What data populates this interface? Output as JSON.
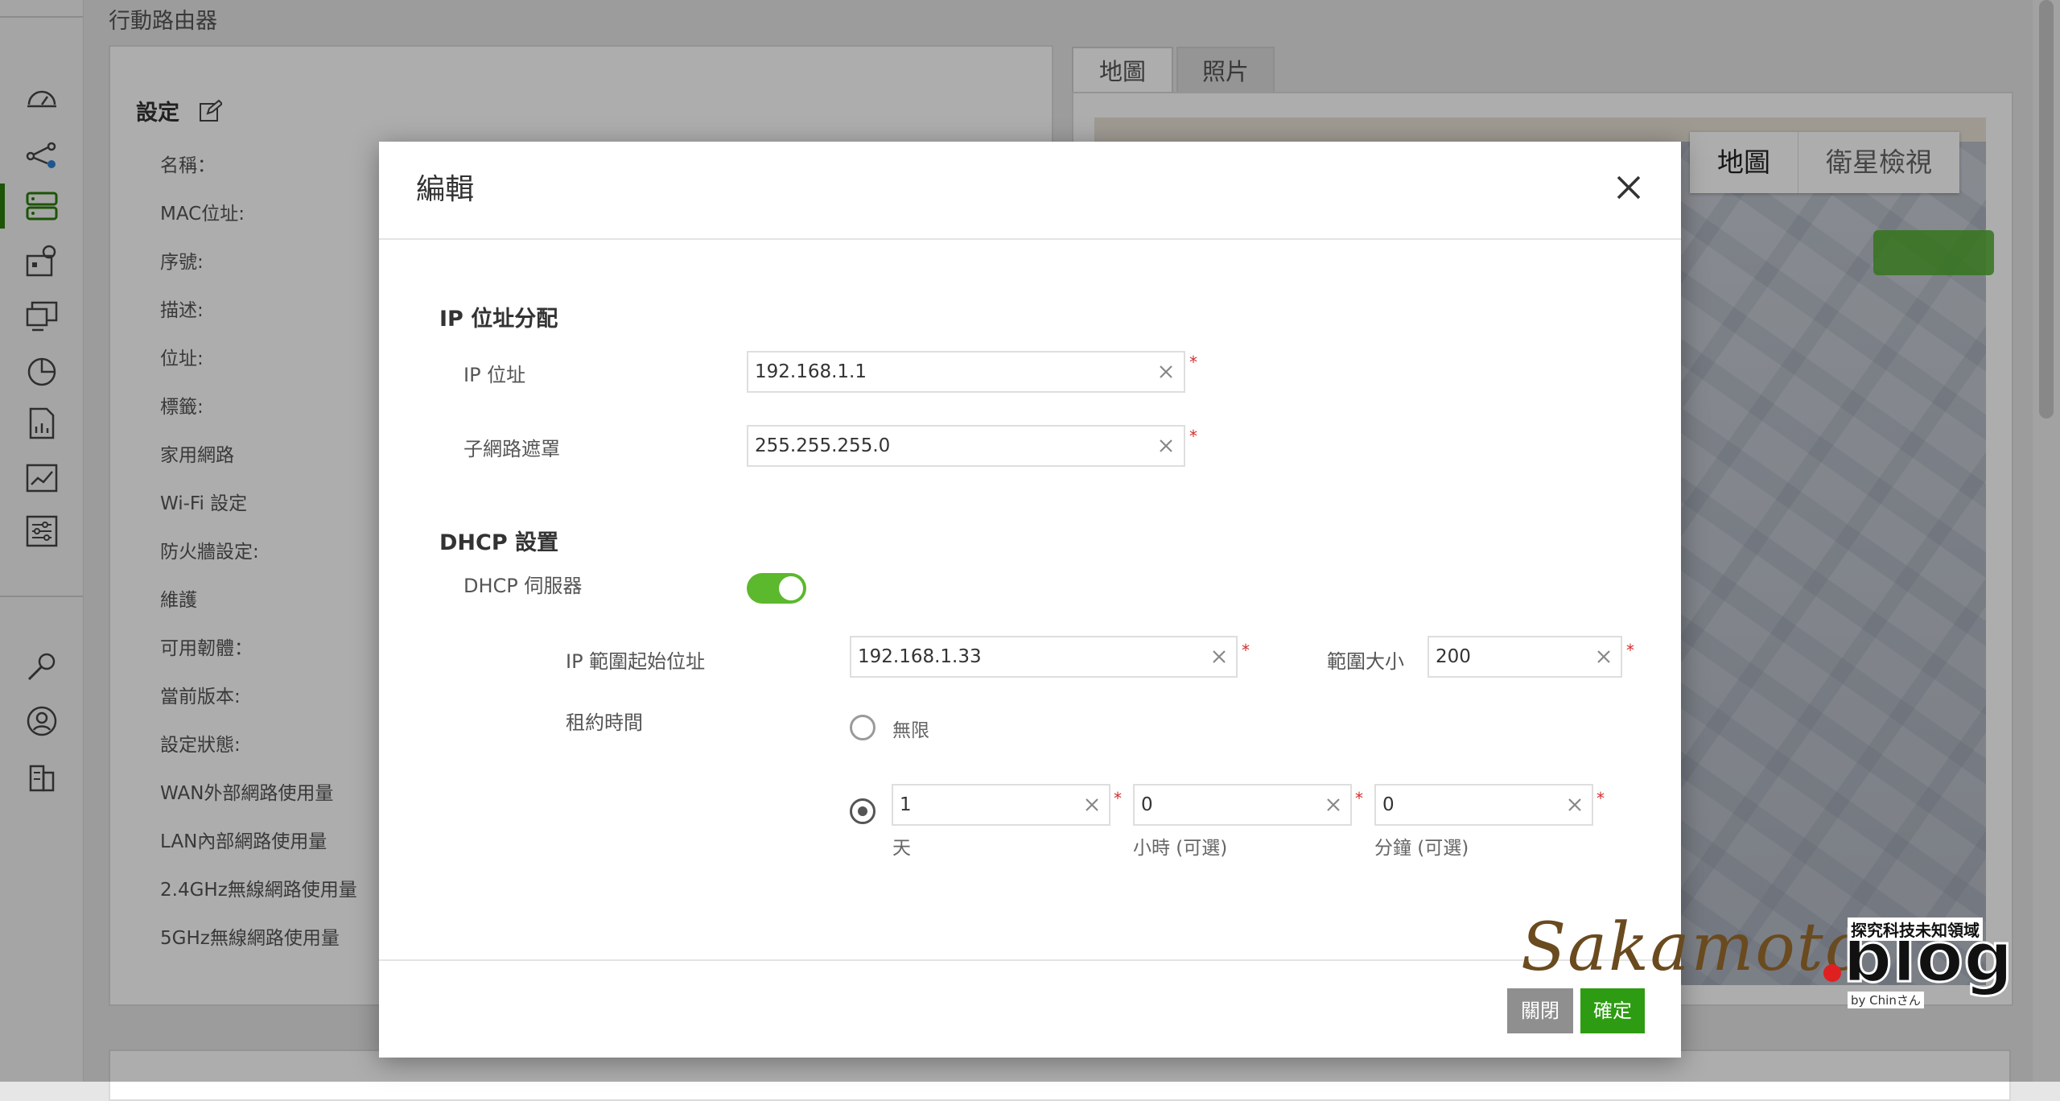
{
  "page": {
    "title": "行動路由器"
  },
  "settings": {
    "heading": "設定",
    "fields": [
      "名稱：",
      "MAC位址:",
      "序號:",
      "描述:",
      "位址:",
      "標籤:",
      "家用網路",
      "Wi-Fi 設定",
      "防火牆設定:",
      "維護",
      "可用韌體：",
      "當前版本:",
      "設定狀態:",
      "WAN外部網路使用量",
      "LAN內部網路使用量",
      "2.4GHz無線網路使用量",
      "5GHz無線網路使用量"
    ]
  },
  "right_tabs": [
    "地圖",
    "照片"
  ],
  "map": {
    "toggle": [
      "地圖",
      "衛星檢視"
    ]
  },
  "sidebar": {
    "icons": [
      "dashboard-icon",
      "topology-icon",
      "devices-icon",
      "site-map-icon",
      "monitor-icon",
      "report-pie-icon",
      "document-chart-icon",
      "line-chart-icon",
      "settings-sliders-icon",
      "tools-icon",
      "support-icon",
      "building-icon"
    ]
  },
  "modal": {
    "title": "編輯",
    "ip_section": {
      "title": "IP 位址分配",
      "ip_label": "IP 位址",
      "ip_value": "192.168.1.1",
      "mask_label": "子網路遮罩",
      "mask_value": "255.255.255.0"
    },
    "dhcp_section": {
      "title": "DHCP 設置",
      "server_label": "DHCP 伺服器",
      "server_enabled": true,
      "start_label": "IP 範圍起始位址",
      "start_value": "192.168.1.33",
      "size_label": "範圍大小",
      "size_value": "200",
      "lease_label": "租約時間",
      "unlimited_label": "無限",
      "days_value": "1",
      "days_label": "天",
      "hours_value": "0",
      "hours_label": "小時 (可選)",
      "minutes_value": "0",
      "minutes_label": "分鐘 (可選)",
      "required_mark": "*"
    },
    "buttons": {
      "cancel": "關閉",
      "ok": "確定"
    }
  },
  "watermark": {
    "script": "Sakamoto",
    "brand": "blog",
    "tagline": "探究科技未知領域",
    "by": "by Chinさん"
  },
  "colors": {
    "accent_green": "#2e9c12",
    "toggle_green": "#5cb82c",
    "required_red": "#d32f2f"
  }
}
